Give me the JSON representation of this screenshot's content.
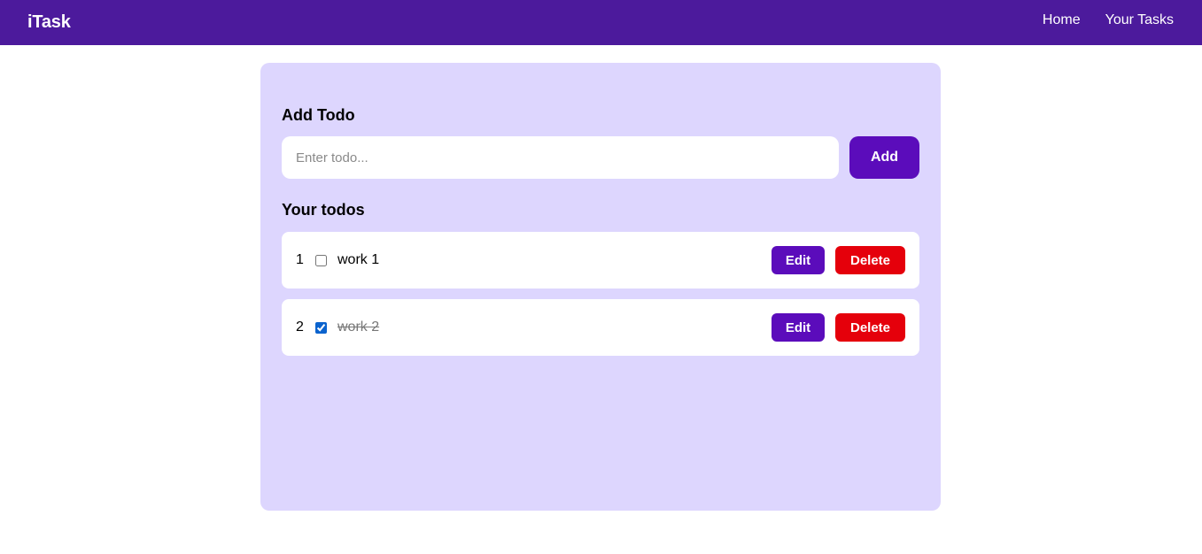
{
  "navbar": {
    "brand": "iTask",
    "links": [
      "Home",
      "Your Tasks"
    ],
    "color": "#4c1a9c"
  },
  "add_section": {
    "title": "Add Todo",
    "input_placeholder": "Enter todo...",
    "input_value": "",
    "add_label": "Add"
  },
  "todos_section": {
    "title": "Your todos",
    "items": [
      {
        "index": "1",
        "text": "work 1",
        "completed": false,
        "edit_label": "Edit",
        "delete_label": "Delete"
      },
      {
        "index": "2",
        "text": "work 2",
        "completed": true,
        "edit_label": "Edit",
        "delete_label": "Delete"
      }
    ]
  },
  "colors": {
    "card_bg": "#ddd6fe",
    "primary_button": "#5b0cbb",
    "delete_button": "#e5000b"
  }
}
